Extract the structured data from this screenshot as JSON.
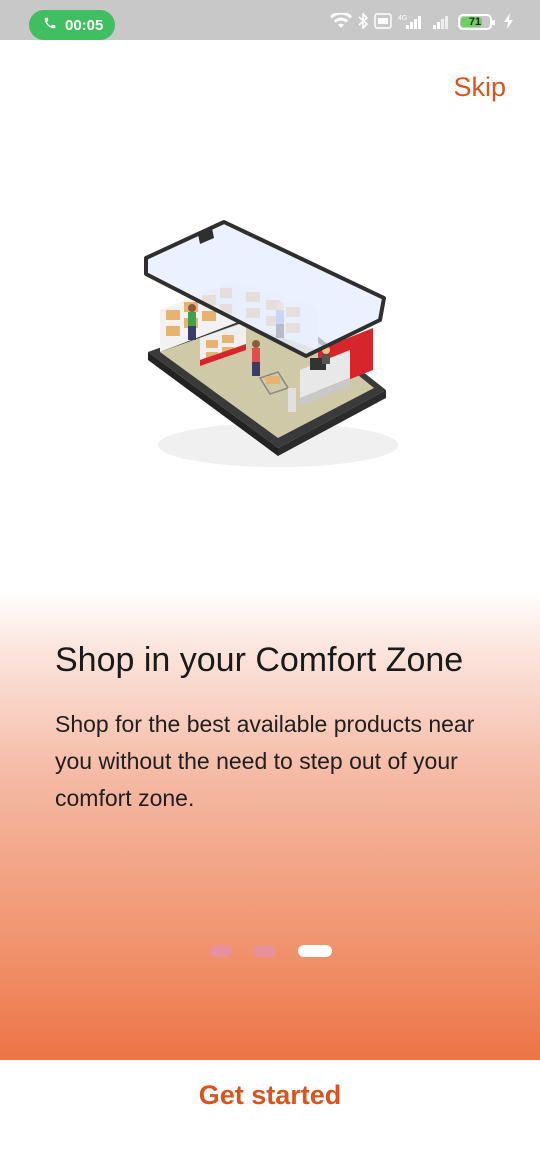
{
  "status_bar": {
    "call_time": "00:05",
    "network_badge": "4G",
    "battery_level": "71",
    "battery_fraction": 0.71,
    "colors": {
      "bar": "#c8c8c8",
      "call_pill": "#3fbf5f",
      "battery_fill": "#6ad35b"
    },
    "icons": [
      "phone-icon",
      "wifi-icon",
      "bluetooth-icon",
      "volte-icon",
      "signal-icon",
      "signal-icon",
      "battery-icon",
      "charging-icon"
    ]
  },
  "onboarding": {
    "skip_label": "Skip",
    "title": "Shop in your Comfort Zone",
    "description": "Shop for the best available products near you without the need to step out of your comfort zone.",
    "page_indicator": {
      "total": 3,
      "current": 3
    },
    "cta_label": "Get started",
    "colors": {
      "accent": "#d9541e",
      "gradient_end": "#ed7446",
      "dot_inactive": "#e6919c",
      "dot_active": "#ffffff"
    }
  }
}
